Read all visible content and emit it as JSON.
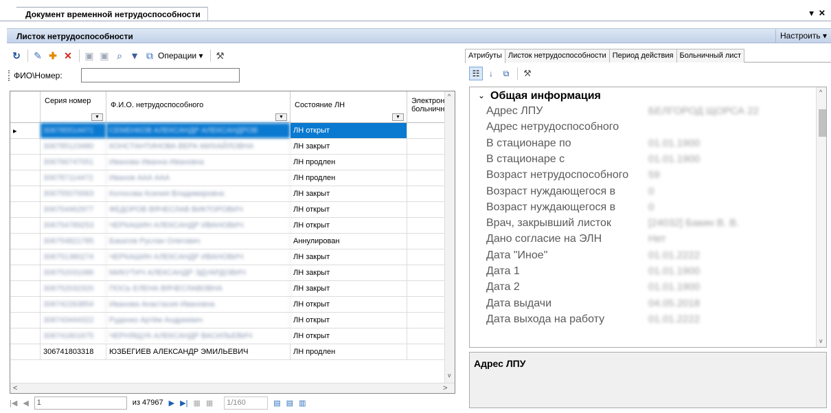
{
  "window": {
    "doc_tab": "Документ временной нетрудоспособности",
    "controls": "▾ ✕"
  },
  "header": {
    "title": "Листок нетрудоспособности",
    "config_label": "Настроить ▾"
  },
  "toolbar": {
    "operations_label": "Операции ▾"
  },
  "search": {
    "label": "ФИО\\Номер:",
    "value": ""
  },
  "grid": {
    "columns": [
      "Серия номер",
      "Ф.И.О. нетрудоспособного",
      "Состояние ЛН",
      "Электронный больничный"
    ],
    "rows": [
      {
        "series": "306785514471",
        "name": "СЕМЕНКОВ АЛЕКСАНДР АЛЕКСАНДРОВ",
        "state": "ЛН открыт"
      },
      {
        "series": "306785123480",
        "name": "КОНСТАНТИНОВА ВЕРА МИХАЙЛОВНА",
        "state": "ЛН закрыт"
      },
      {
        "series": "306766747051",
        "name": "Иванова Иванна Ивановна",
        "state": "ЛН продлен"
      },
      {
        "series": "306787114472",
        "name": "Иванов ААА ААА",
        "state": "ЛН продлен"
      },
      {
        "series": "306755070063",
        "name": "Колосова Ксения Владимировна",
        "state": "ЛН закрыт"
      },
      {
        "series": "306754462977",
        "name": "ФЕДОРОВ ВЯЧЕСЛАВ ВИКТОРОВИЧ",
        "state": "ЛН открыт"
      },
      {
        "series": "306754789253",
        "name": "ЧЕРКАШИН АЛЕКСАНДР ИВАНОВИЧ",
        "state": "ЛН открыт"
      },
      {
        "series": "306754821785",
        "name": "Бакатов Руслан Олегович",
        "state": "Аннулирован"
      },
      {
        "series": "306751380274",
        "name": "ЧЕРКАШИН АЛЕКСАНДР ИВАНОВИЧ",
        "state": "ЛН закрыт"
      },
      {
        "series": "306752031086",
        "name": "МИКУТИЧ АЛЕКСАНДР ЭДУАРДОВИЧ",
        "state": "ЛН закрыт"
      },
      {
        "series": "306752032320",
        "name": "ПОСЬ ЕЛЕНА ВЯЧЕСЛАВОВНА",
        "state": "ЛН закрыт"
      },
      {
        "series": "306742263854",
        "name": "Иванова Анастасия Ивановна",
        "state": "ЛН открыт"
      },
      {
        "series": "306743444322",
        "name": "Руденко Артём Андреевич",
        "state": "ЛН открыт"
      },
      {
        "series": "306741801675",
        "name": "ЧЕРНЯЩУК АЛЕКСАНДР ВАСИЛЬЕВИЧ",
        "state": "ЛН открыт"
      },
      {
        "series": "306741803318",
        "name": "ЮЗБЕГИЕВ АЛЕКСАНДР ЭМИЛЬЕВИЧ",
        "state": "ЛН продлен"
      }
    ]
  },
  "pager": {
    "current": "1",
    "total": "из 47967",
    "page": "1/160"
  },
  "right": {
    "tabs": [
      "Атрибуты",
      "Листок нетрудоспособности",
      "Период действия",
      "Больничный лист"
    ],
    "category": "Общая информация",
    "props": [
      {
        "name": "Адрес ЛПУ",
        "value": "БЕЛГОРОД ЩОРСА 22"
      },
      {
        "name": "Адрес нетрудоспособного",
        "value": ""
      },
      {
        "name": "В стационаре по",
        "value": "01.01.1900"
      },
      {
        "name": "В стационаре с",
        "value": "01.01.1900"
      },
      {
        "name": "Возраст нетрудоспособного",
        "value": "59"
      },
      {
        "name": "Возраст нуждающегося в",
        "value": "0"
      },
      {
        "name": "Возраст нуждающегося в",
        "value": "0"
      },
      {
        "name": "Врач, закрывший листок",
        "value": "[24032] Бакин В. В."
      },
      {
        "name": "Дано согласие на ЭЛН",
        "value": "Нет"
      },
      {
        "name": "Дата \"Иное\"",
        "value": "01.01.2222"
      },
      {
        "name": "Дата 1",
        "value": "01.01.1900"
      },
      {
        "name": "Дата 2",
        "value": "01.01.1900"
      },
      {
        "name": "Дата выдачи",
        "value": "04.05.2018"
      },
      {
        "name": "Дата выхода на работу",
        "value": "01.01.2222"
      }
    ],
    "description_title": "Адрес ЛПУ"
  }
}
